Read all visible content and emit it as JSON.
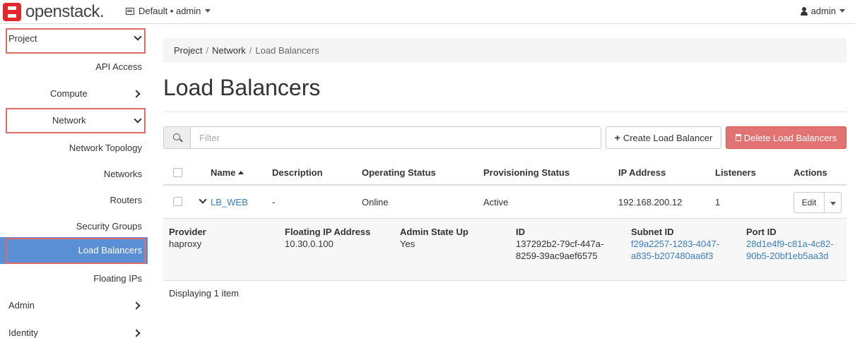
{
  "header": {
    "logo_text": "openstack.",
    "project_switcher": "Default • admin",
    "user": "admin"
  },
  "sidebar": {
    "project": "Project",
    "api_access": "API Access",
    "compute": "Compute",
    "network": "Network",
    "network_items": [
      "Network Topology",
      "Networks",
      "Routers",
      "Security Groups",
      "Load Balancers",
      "Floating IPs"
    ],
    "admin": "Admin",
    "identity": "Identity"
  },
  "breadcrumb": [
    "Project",
    "Network",
    "Load Balancers"
  ],
  "page_title": "Load Balancers",
  "toolbar": {
    "filter_placeholder": "Filter",
    "create_label": "Create Load Balancer",
    "delete_label": "Delete Load Balancers"
  },
  "table": {
    "columns": [
      "Name",
      "Description",
      "Operating Status",
      "Provisioning Status",
      "IP Address",
      "Listeners",
      "Actions"
    ],
    "rows": [
      {
        "name": "LB_WEB",
        "description": "-",
        "operating_status": "Online",
        "provisioning_status": "Active",
        "ip_address": "192.168.200.12",
        "listeners": "1",
        "action": "Edit"
      }
    ],
    "detail": {
      "provider_label": "Provider",
      "provider": "haproxy",
      "floating_ip_label": "Floating IP Address",
      "floating_ip": "10.30.0.100",
      "admin_state_label": "Admin State Up",
      "admin_state": "Yes",
      "id_label": "ID",
      "id_line1": "137292b2-79cf-447a-",
      "id_line2": "8259-39ac9aef6575",
      "subnet_label": "Subnet ID",
      "subnet_line1": "f29a2257-1283-4047-",
      "subnet_line2": "a835-b207480aa6f3",
      "port_label": "Port ID",
      "port_line1": "28d1e4f9-c81a-4c82-",
      "port_line2": "90b5-20bf1eb5aa3d"
    },
    "footer": "Displaying 1 item"
  },
  "colors": {
    "active_nav": "#5b8fd5",
    "highlight_box": "#e06b6b",
    "danger_button": "#e27373",
    "link": "#3a7ebf"
  }
}
